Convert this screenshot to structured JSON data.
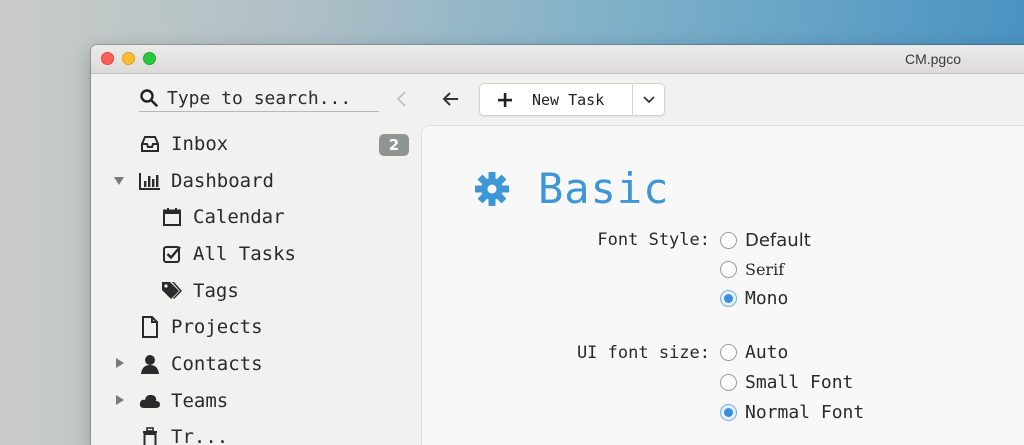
{
  "window": {
    "title": "CM.pgco"
  },
  "search": {
    "placeholder": "Type to search..."
  },
  "sidebar": {
    "inbox": {
      "label": "Inbox",
      "badge": "2"
    },
    "dashboard": {
      "label": "Dashboard"
    },
    "calendar": {
      "label": "Calendar"
    },
    "all_tasks": {
      "label": "All Tasks"
    },
    "tags": {
      "label": "Tags"
    },
    "projects": {
      "label": "Projects"
    },
    "contacts": {
      "label": "Contacts"
    },
    "teams": {
      "label": "Teams"
    },
    "partial": {
      "label": "Tr..."
    }
  },
  "toolbar": {
    "new_task_label": "New Task"
  },
  "settings": {
    "heading": "Basic",
    "font_style": {
      "label": "Font Style:",
      "options": [
        "Default",
        "Serif",
        "Mono"
      ],
      "selected": "Mono"
    },
    "ui_font_size": {
      "label": "UI font size:",
      "options": [
        "Auto",
        "Small Font",
        "Normal Font"
      ],
      "selected": "Normal Font"
    }
  },
  "colors": {
    "accent": "#3d97d6",
    "radio_selected": "#3b8fe0",
    "badge": "#8f9592"
  }
}
